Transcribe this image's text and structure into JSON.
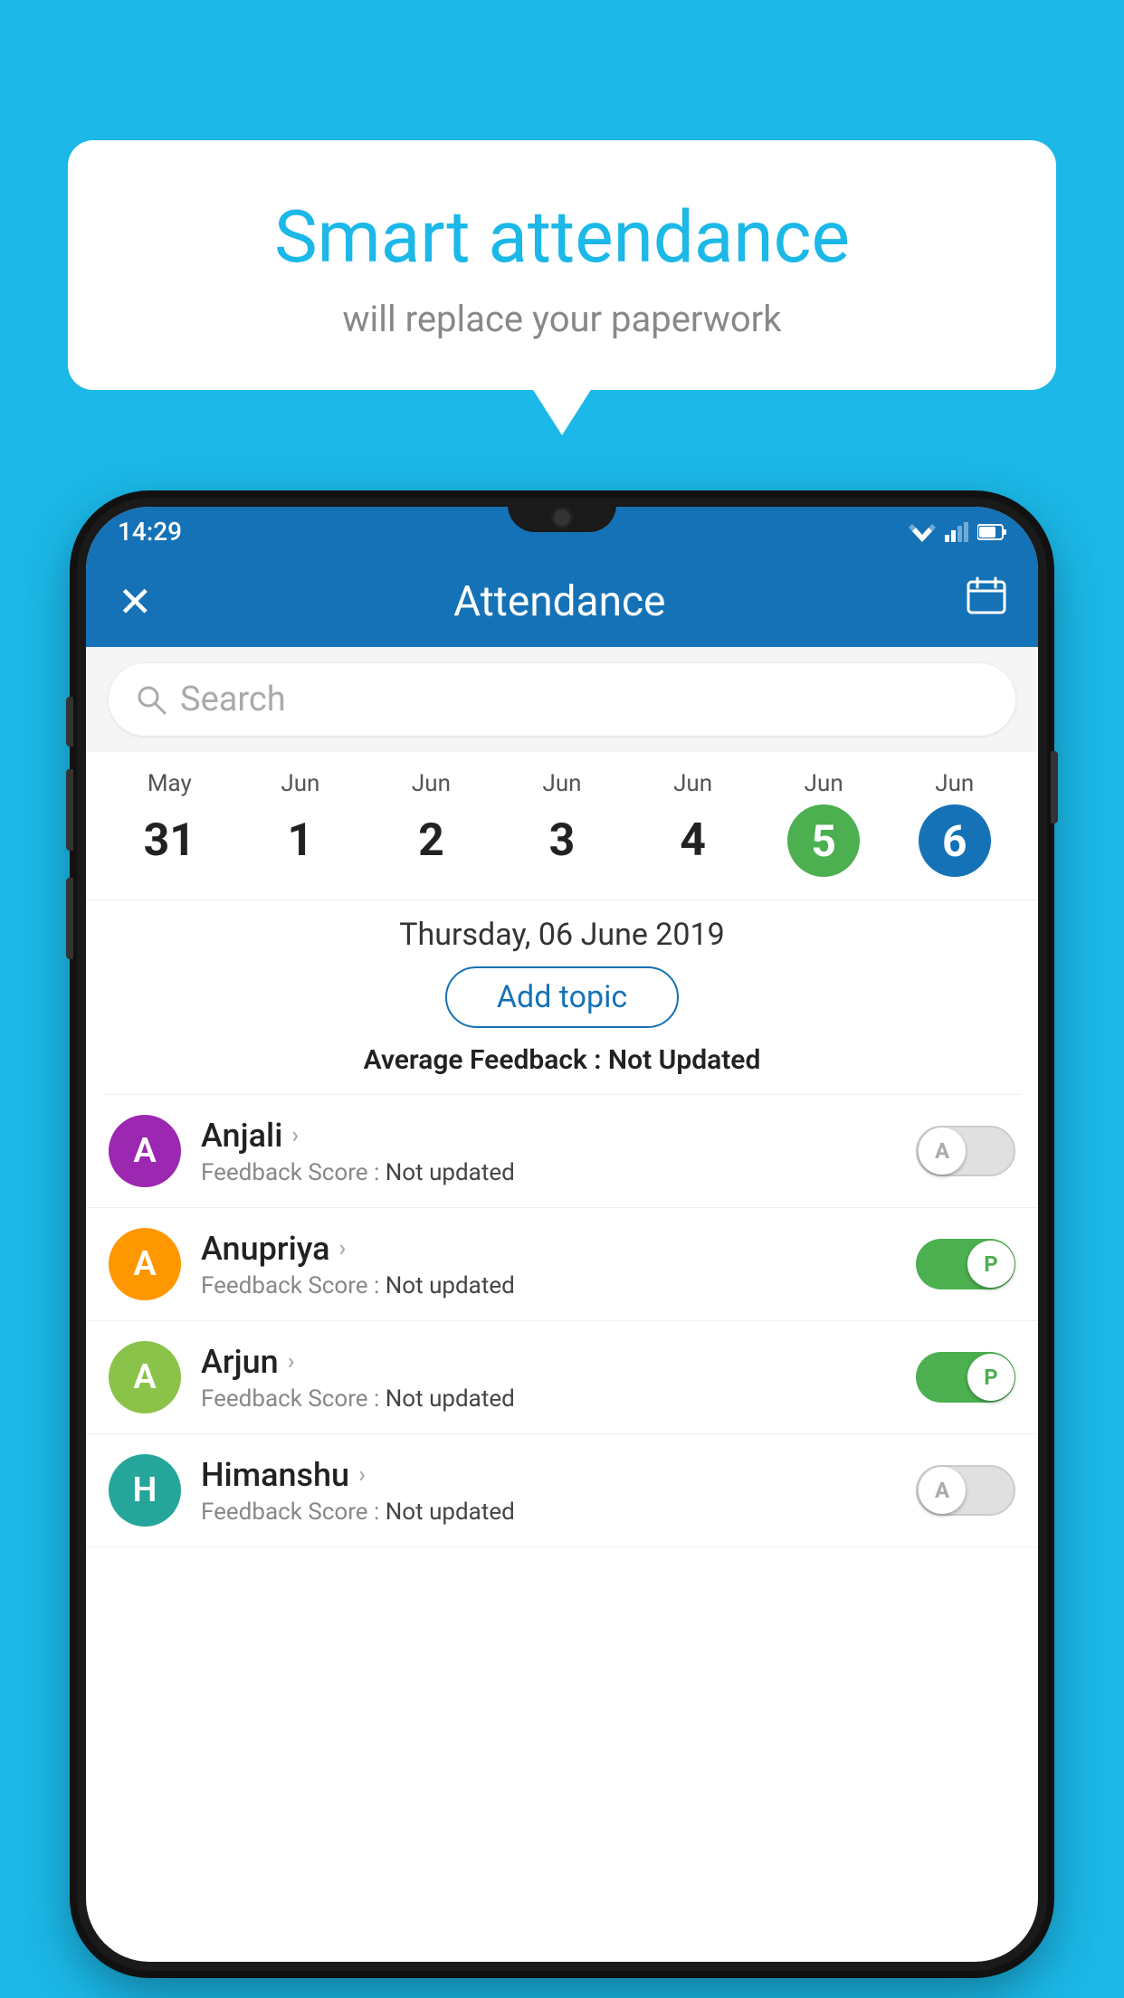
{
  "background_color": "#1bb8e8",
  "bubble": {
    "title": "Smart attendance",
    "subtitle": "will replace your paperwork"
  },
  "status_bar": {
    "time": "14:29"
  },
  "app_bar": {
    "title": "Attendance",
    "close_label": "✕",
    "calendar_label": "📅"
  },
  "search": {
    "placeholder": "Search"
  },
  "calendar": {
    "days": [
      {
        "month": "May",
        "date": "31",
        "highlight": "none"
      },
      {
        "month": "Jun",
        "date": "1",
        "highlight": "none"
      },
      {
        "month": "Jun",
        "date": "2",
        "highlight": "none"
      },
      {
        "month": "Jun",
        "date": "3",
        "highlight": "none"
      },
      {
        "month": "Jun",
        "date": "4",
        "highlight": "none"
      },
      {
        "month": "Jun",
        "date": "5",
        "highlight": "green"
      },
      {
        "month": "Jun",
        "date": "6",
        "highlight": "blue"
      }
    ],
    "selected_date": "Thursday, 06 June 2019"
  },
  "add_topic_label": "Add topic",
  "avg_feedback_label": "Average Feedback :",
  "avg_feedback_value": "Not Updated",
  "students": [
    {
      "name": "Anjali",
      "initial": "A",
      "avatar_color": "purple",
      "feedback_label": "Feedback Score :",
      "feedback_value": "Not updated",
      "toggle": "off",
      "toggle_letter": "A"
    },
    {
      "name": "Anupriya",
      "initial": "A",
      "avatar_color": "orange",
      "feedback_label": "Feedback Score :",
      "feedback_value": "Not updated",
      "toggle": "on",
      "toggle_letter": "P"
    },
    {
      "name": "Arjun",
      "initial": "A",
      "avatar_color": "lightgreen",
      "feedback_label": "Feedback Score :",
      "feedback_value": "Not updated",
      "toggle": "on",
      "toggle_letter": "P"
    },
    {
      "name": "Himanshu",
      "initial": "H",
      "avatar_color": "teal",
      "feedback_label": "Feedback Score :",
      "feedback_value": "Not updated",
      "toggle": "off",
      "toggle_letter": "A"
    }
  ]
}
